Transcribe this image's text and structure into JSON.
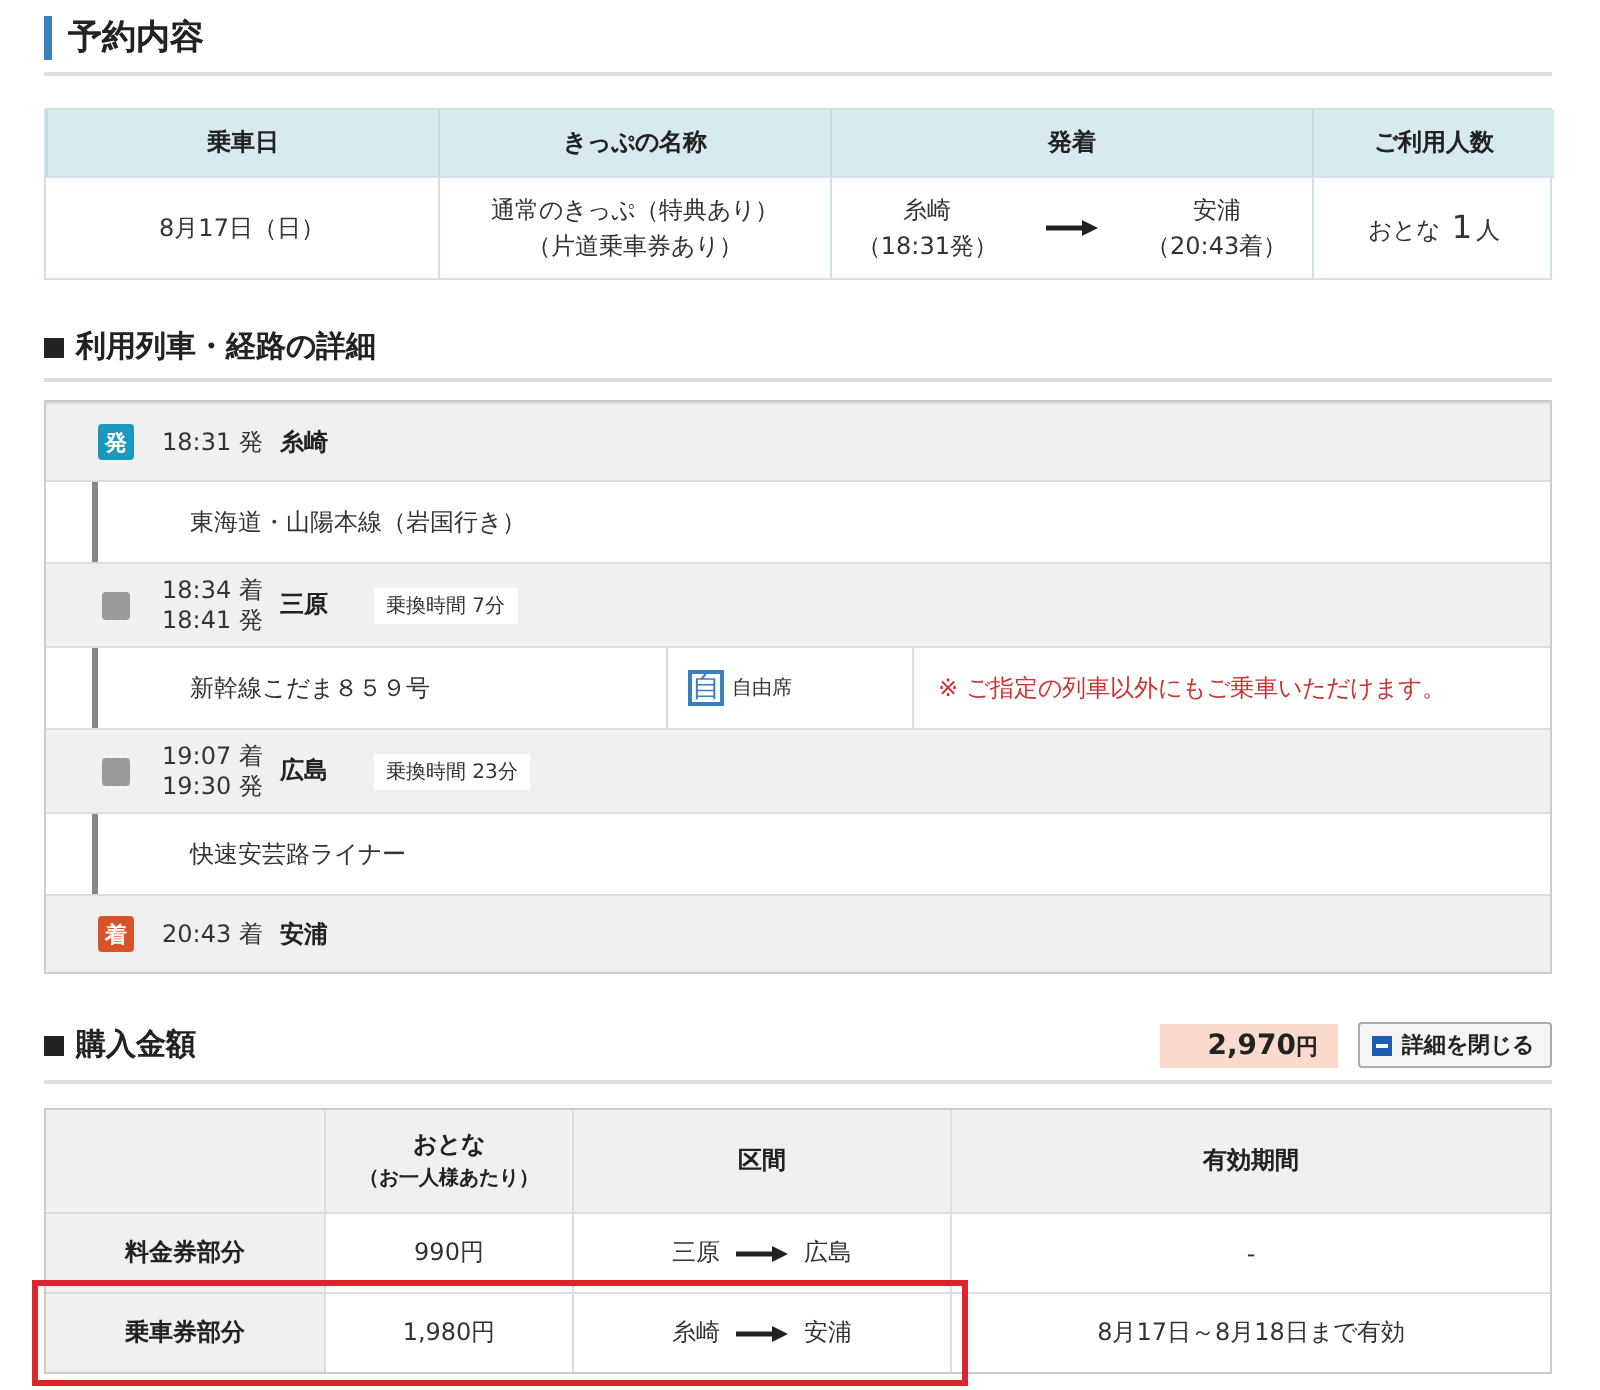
{
  "reservation": {
    "title": "予約内容",
    "columns": [
      "乗車日",
      "きっぷの名称",
      "発着",
      "ご利用人数"
    ],
    "date": "8月17日（日）",
    "ticket_name": [
      "通常のきっぷ（特典あり）",
      "（片道乗車券あり）"
    ],
    "from": {
      "station": "糸崎",
      "time": "（18:31発）"
    },
    "to": {
      "station": "安浦",
      "time": "（20:43着）"
    },
    "passengers": {
      "label": "おとな",
      "count": "1",
      "unit": "人"
    }
  },
  "route": {
    "title": "利用列車・経路の詳細",
    "steps": [
      {
        "kind": "depart",
        "badge": "発",
        "times": [
          "18:31 発"
        ],
        "station": "糸崎"
      },
      {
        "kind": "segment",
        "train": "東海道・山陽本線（岩国行き）"
      },
      {
        "kind": "transfer",
        "times": [
          "18:34 着",
          "18:41 発"
        ],
        "station": "三原",
        "transfer": "乗換時間 7分"
      },
      {
        "kind": "segment",
        "train": "新幹線こだま８５９号",
        "seat_icon": "自",
        "seat": "自由席",
        "note": "※ ご指定の列車以外にもご乗車いただけます。"
      },
      {
        "kind": "transfer",
        "times": [
          "19:07 着",
          "19:30 発"
        ],
        "station": "広島",
        "transfer": "乗換時間 23分"
      },
      {
        "kind": "segment",
        "train": "快速安芸路ライナー"
      },
      {
        "kind": "arrive",
        "badge": "着",
        "times": [
          "20:43 着"
        ],
        "station": "安浦"
      }
    ]
  },
  "purchase": {
    "title": "購入金額",
    "total": "2,970",
    "total_unit": "円",
    "toggle_button": "詳細を閉じる",
    "columns": [
      {
        "label": "おとな",
        "sub": "（お一人様あたり）"
      },
      {
        "label": "区間"
      },
      {
        "label": "有効期間"
      }
    ],
    "rows": [
      {
        "label": "料金券部分",
        "price": "990円",
        "from": "三原",
        "to": "広島",
        "validity": "-",
        "highlighted": false
      },
      {
        "label": "乗車券部分",
        "price": "1,980円",
        "from": "糸崎",
        "to": "安浦",
        "validity": "8月17日～8月18日まで有効",
        "highlighted": true
      }
    ]
  }
}
